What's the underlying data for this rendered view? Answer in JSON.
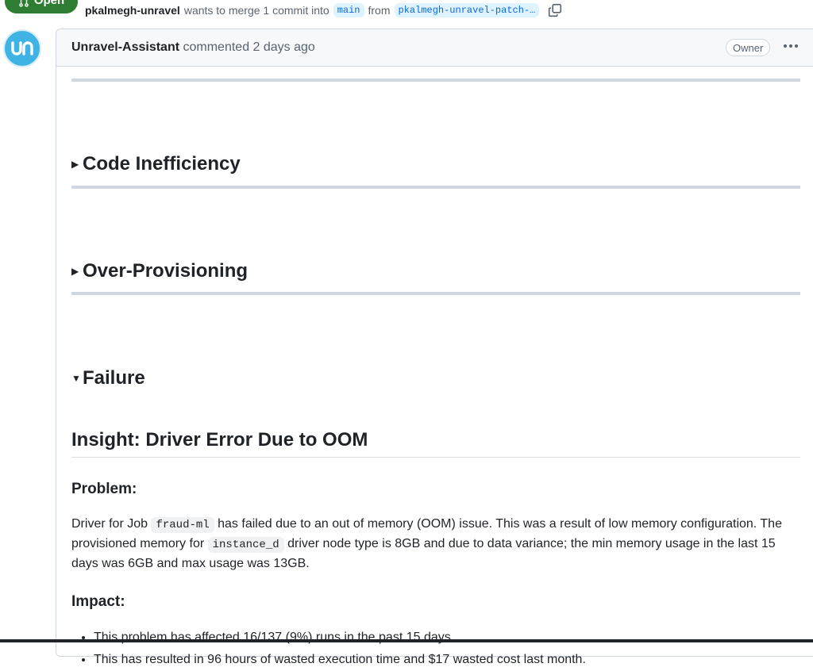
{
  "header": {
    "state_label": "Open",
    "author": "pkalmegh-unravel",
    "merge_text": "wants to merge 1 commit into",
    "base_branch": "main",
    "from_text": "from",
    "head_branch": "pkalmegh-unravel-patch-…"
  },
  "comment": {
    "author": "Unravel-Assistant",
    "meta": "commented 2 days ago",
    "role_badge": "Owner",
    "menu_icon": "kebab-horizontal-icon",
    "sections": [
      {
        "label": "Code Inefficiency",
        "expanded": false
      },
      {
        "label": "Over-Provisioning",
        "expanded": false
      },
      {
        "label": "Failure",
        "expanded": true
      }
    ],
    "insight_title": "Insight: Driver Error Due to OOM",
    "problem_heading": "Problem:",
    "problem": {
      "t1": "Driver for Job ",
      "code1": "fraud-ml",
      "t2": " has failed due to an out of memory (OOM) issue. This was a result of low memory configuration. The provisioned memory for ",
      "code2": "instance_d",
      "t3": " driver node type is 8GB and due to data variance; the min memory usage in the last 15 days was 6GB and max usage was 13GB."
    },
    "impact_heading": "Impact:",
    "impact_items": [
      "This problem has affected 16/137 (9%) runs in the past 15 days.",
      "This has resulted in 96 hours of wasted execution time and $17 wasted cost last month."
    ]
  },
  "colors": {
    "open_badge": "#2f7d32",
    "avatar_bg": "#3fb3e4",
    "branch_bg": "#ddf4ff",
    "branch_text": "#0969da"
  }
}
